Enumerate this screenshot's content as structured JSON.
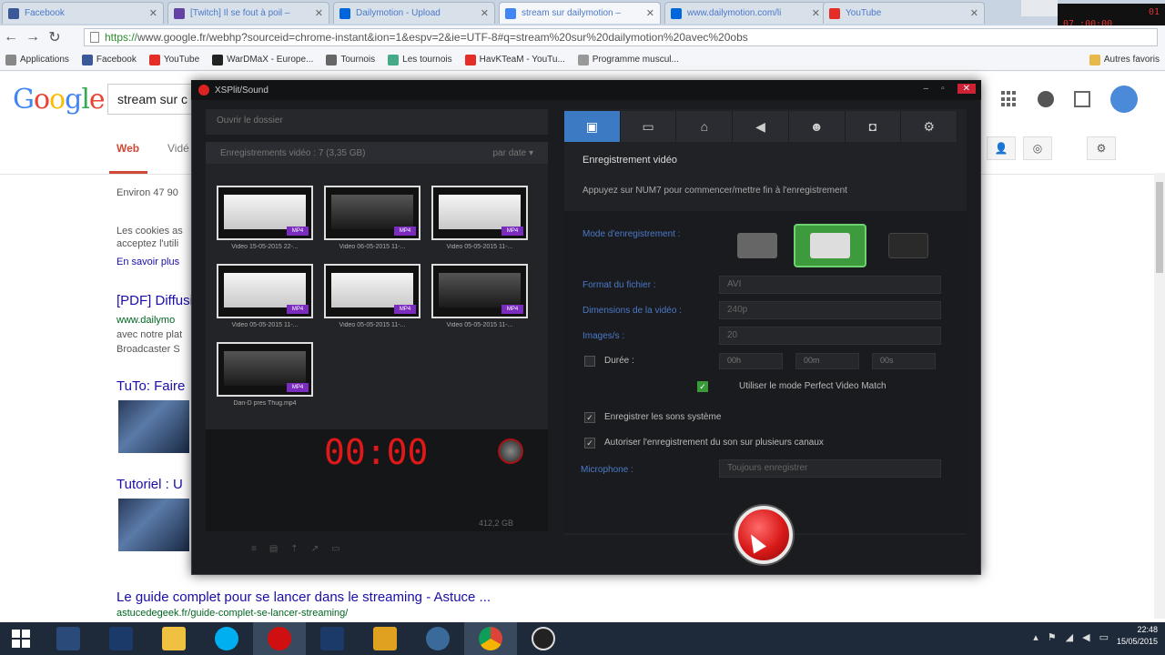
{
  "browser": {
    "tabs": [
      {
        "label": "Facebook",
        "color": "#3b5998"
      },
      {
        "label": "[Twitch] Il se fout à poil –",
        "color": "#6441a5"
      },
      {
        "label": "Dailymotion - Upload",
        "color": "#0066dc"
      },
      {
        "label": "stream sur dailymotion –",
        "color": "#4285f4"
      },
      {
        "label": "www.dailymotion.com/li",
        "color": "#0066dc"
      },
      {
        "label": "YouTube",
        "color": "#e52d27"
      }
    ],
    "url_https": "https://",
    "url_rest": "www.google.fr/webhp?sourceid=chrome-instant&ion=1&espv=2&ie=UTF-8#q=stream%20sur%20dailymotion%20avec%20obs",
    "bookmarks": [
      {
        "label": "Applications",
        "color": "#888"
      },
      {
        "label": "Facebook",
        "color": "#3b5998"
      },
      {
        "label": "YouTube",
        "color": "#e52d27"
      },
      {
        "label": "WarDMaX - Europe...",
        "color": "#222"
      },
      {
        "label": "Tournois",
        "color": "#666"
      },
      {
        "label": "Les tournois",
        "color": "#4a8"
      },
      {
        "label": "HavKTeaM - YouTu...",
        "color": "#e52d27"
      },
      {
        "label": "Programme muscul...",
        "color": "#999"
      }
    ],
    "other_bookmarks": "Autres favoris",
    "rec_overlay": {
      "l1": "01",
      "l2": "07 :00:00"
    }
  },
  "google": {
    "logo": "Google",
    "query": "stream sur c",
    "tab_web": "Web",
    "tab_videos": "Vidé",
    "results_count": "Environ 47 90",
    "cookies_l1": "Les cookies as",
    "cookies_l2": "acceptez l'utili",
    "learn_more": "En savoir plus",
    "r1_title": "[PDF] Diffusio",
    "r1_url": "www.dailymo",
    "r1_s1": "avec notre plat",
    "r1_s2": "Broadcaster S",
    "r2_title": "TuTo: Faire",
    "r3_title": "Tutoriel : U",
    "r4_title": "Le guide complet pour se lancer dans le streaming - Astuce ...",
    "r4_url": "astucedegeek.fr/guide-complet-se-lancer-streaming/"
  },
  "app": {
    "title": "XSPlit/Sound",
    "toolbar": "Ouvrir le dossier",
    "list_header": "Enregistrements vidéo : 7 (3,35 GB)",
    "sort": "par date",
    "videos": [
      {
        "caption": "Video 15-05-2015 22-...",
        "light": true
      },
      {
        "caption": "Video 06-05-2015 11-...",
        "light": false
      },
      {
        "caption": "Video 05-05-2015 11-...",
        "light": true
      },
      {
        "caption": "Video 05-05-2015 11-...",
        "light": true
      },
      {
        "caption": "Video 05-05-2015 11-...",
        "light": true
      },
      {
        "caption": "Video 05-05-2015 11-...",
        "light": false
      },
      {
        "caption": "Dan-D pres Thug.mp4",
        "light": false
      }
    ],
    "badge": "MP4",
    "timer": "00:00",
    "disk_free": "412,2 GB",
    "section_title": "Enregistrement vidéo",
    "section_desc": "Appuyez sur NUM7 pour commencer/mettre fin à l'enregistrement",
    "mode_label": "Mode d'enregistrement :",
    "format_label": "Format du fichier :",
    "format_value": "AVI",
    "dim_label": "Dimensions de la vidéo :",
    "dim_value": "240p",
    "fps_label": "Images/s :",
    "fps_value": "20",
    "duree_label": "Durée :",
    "dur_h": "00h",
    "dur_m": "00m",
    "dur_s": "00s",
    "pvm_label": "Utiliser le mode Perfect Video Match",
    "sys_sound_label": "Enregistrer les sons système",
    "multi_channel_label": "Autoriser l'enregistrement du son sur plusieurs canaux",
    "mic_label": "Microphone :",
    "mic_value": "Toujours enregistrer"
  },
  "taskbar": {
    "time": "22:48",
    "date": "15/05/2015",
    "apps": [
      "#2a4a7a",
      "#1b3a6a",
      "#f0c040",
      "#00aff0",
      "#d01010",
      "#1b3a6a",
      "#e0a020",
      "#3a6a9a",
      "#e0a020",
      "#222"
    ]
  }
}
